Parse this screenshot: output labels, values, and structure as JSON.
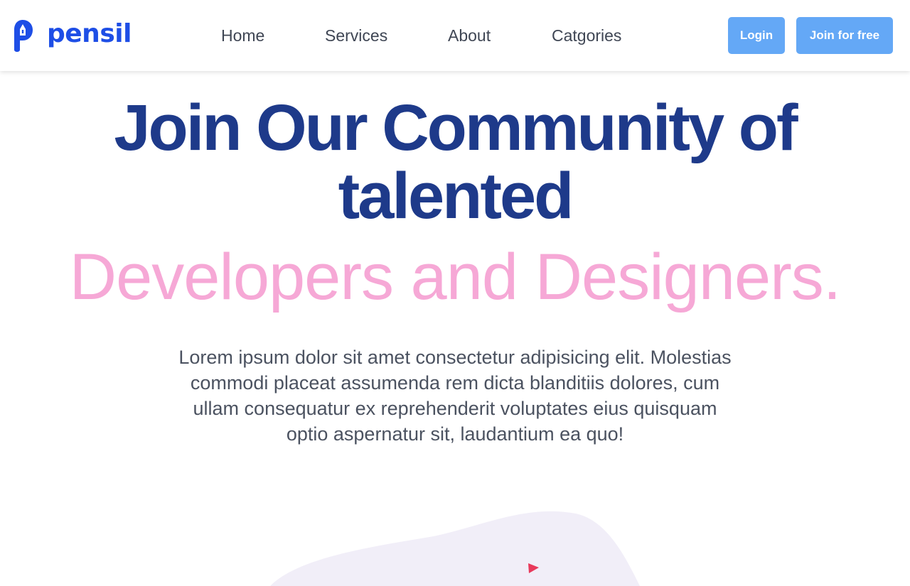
{
  "header": {
    "logo_text": "pensil",
    "nav": [
      {
        "label": "Home"
      },
      {
        "label": "Services"
      },
      {
        "label": "About"
      },
      {
        "label": "Catgories"
      }
    ],
    "login_label": "Login",
    "join_label": "Join for free"
  },
  "hero": {
    "title_line1": "Join Our Community of",
    "title_line2": "talented",
    "subtitle": "Developers and Designers.",
    "description": "Lorem ipsum dolor sit amet consectetur adipisicing elit. Molestias commodi placeat assumenda rem dicta blanditiis dolores, cum ullam consequatur ex reprehenderit voluptates eius quisquam optio aspernatur sit, laudantium ea quo!"
  },
  "colors": {
    "brand_blue": "#1e4ee6",
    "heading_navy": "#1e3a8a",
    "accent_pink": "#f6a8d6",
    "button_blue": "#64a8f6"
  },
  "icons": {
    "logo": "pen-nib-logo-icon",
    "illustration": "blob-illustration"
  }
}
